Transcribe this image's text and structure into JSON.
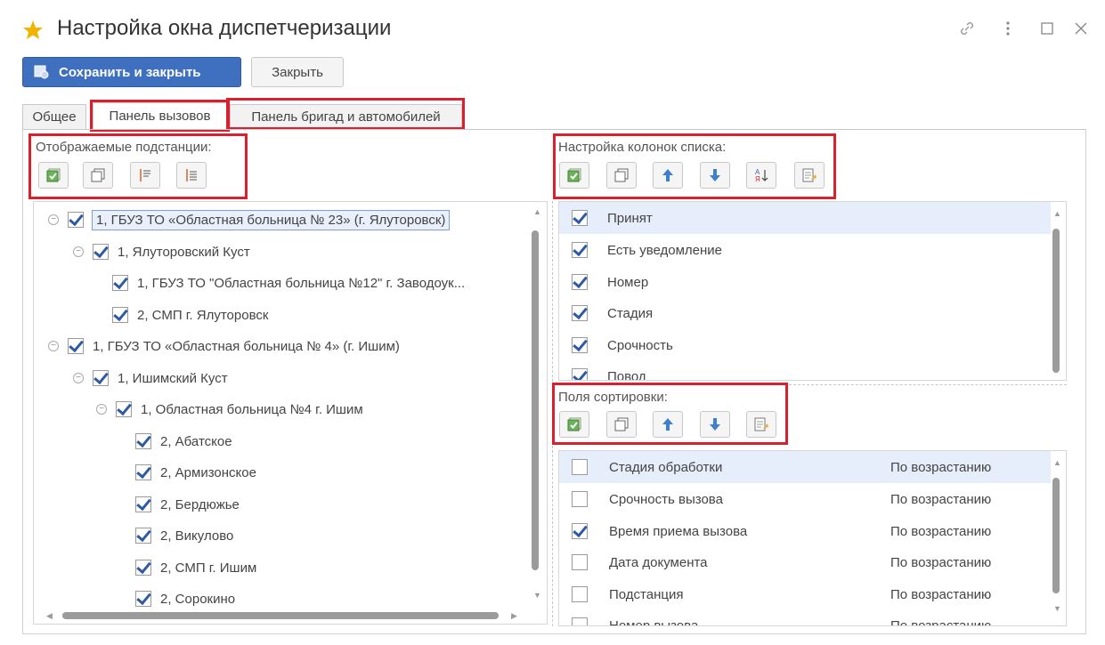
{
  "window": {
    "title": "Настройка окна диспетчеризации",
    "controls": [
      "link-icon",
      "more-icon",
      "maximize-icon",
      "close-icon"
    ]
  },
  "toolbar": {
    "save_close_label": "Сохранить и закрыть",
    "close_label": "Закрыть"
  },
  "tabs": [
    {
      "label": "Общее",
      "active": false
    },
    {
      "label": "Панель вызовов",
      "active": true
    },
    {
      "label": "Панель бригад и автомобилей",
      "active": false
    }
  ],
  "left_panel": {
    "group_label": "Отображаемые подстанции:",
    "tree": [
      {
        "label": "1, ГБУЗ ТО «Областная больница № 23» (г. Ялуторовск)",
        "level": 0,
        "checked": true,
        "expanded": true,
        "selected": true
      },
      {
        "label": "1, Ялуторовский Куст",
        "level": 1,
        "checked": true,
        "expanded": true
      },
      {
        "label": "1, ГБУЗ ТО \"Областная больница №12\" г. Заводоук...",
        "level": 2,
        "checked": true
      },
      {
        "label": "2, СМП г. Ялуторовск",
        "level": 2,
        "checked": true
      },
      {
        "label": "1, ГБУЗ ТО «Областная больница № 4» (г. Ишим)",
        "level": 0,
        "checked": true,
        "expanded": true
      },
      {
        "label": "1, Ишимский Куст",
        "level": 1,
        "checked": true,
        "expanded": true
      },
      {
        "label": "1, Областная больница №4 г. Ишим",
        "level": 2,
        "checked": true,
        "expanded": true
      },
      {
        "label": "2, Абатское",
        "level": 3,
        "checked": true
      },
      {
        "label": "2, Армизонское",
        "level": 3,
        "checked": true
      },
      {
        "label": "2, Бердюжье",
        "level": 3,
        "checked": true
      },
      {
        "label": "2, Викулово",
        "level": 3,
        "checked": true
      },
      {
        "label": "2, СМП г. Ишим",
        "level": 3,
        "checked": true
      },
      {
        "label": "2, Сорокино",
        "level": 3,
        "checked": true
      }
    ]
  },
  "columns_panel": {
    "group_label": "Настройка колонок списка:",
    "items": [
      {
        "label": "Принят",
        "checked": true,
        "highlighted": true
      },
      {
        "label": "Есть уведомление",
        "checked": true
      },
      {
        "label": "Номер",
        "checked": true
      },
      {
        "label": "Стадия",
        "checked": true
      },
      {
        "label": "Срочность",
        "checked": true
      },
      {
        "label": "Повод",
        "checked": true
      }
    ]
  },
  "sort_panel": {
    "group_label": "Поля сортировки:",
    "items": [
      {
        "label": "Стадия обработки",
        "order": "По возрастанию",
        "checked": false,
        "highlighted": true
      },
      {
        "label": "Срочность вызова",
        "order": "По возрастанию",
        "checked": false
      },
      {
        "label": "Время приема вызова",
        "order": "По возрастанию",
        "checked": true
      },
      {
        "label": "Дата документа",
        "order": "По возрастанию",
        "checked": false
      },
      {
        "label": "Подстанция",
        "order": "По возрастанию",
        "checked": false
      },
      {
        "label": "Номер вызова",
        "order": "По возрастанию",
        "checked": false
      }
    ]
  },
  "colors": {
    "accent": "#3f6fbf",
    "highlight_box": "#d9202e",
    "star": "#f0b400"
  }
}
